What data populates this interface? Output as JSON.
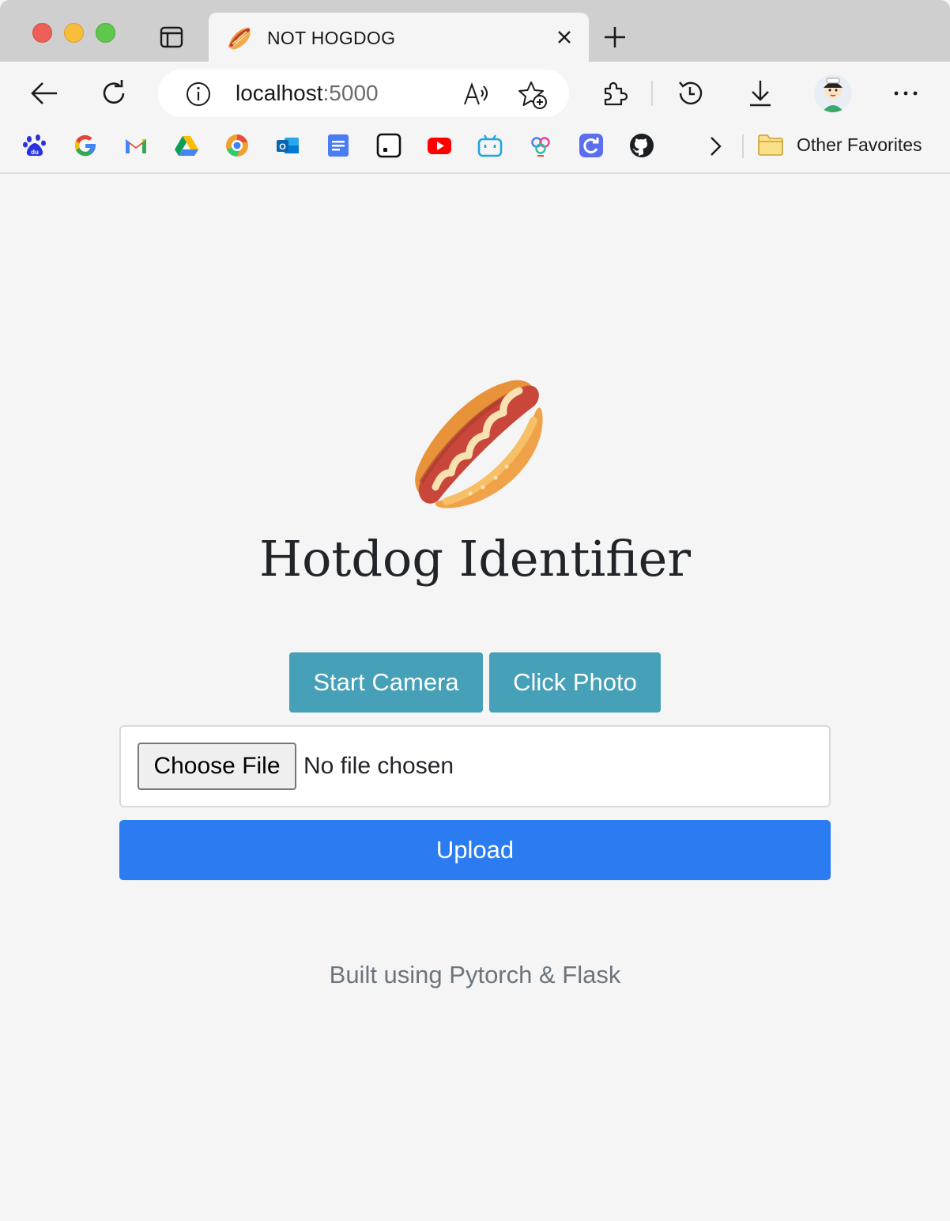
{
  "browser": {
    "tab": {
      "title": "NOT HOGDOG"
    },
    "address": {
      "host": "localhost",
      "port": ":5000"
    },
    "favorites": {
      "items": [
        "baidu-icon",
        "google-icon",
        "gmail-icon",
        "drive-icon",
        "chrome-like-icon",
        "outlook-icon",
        "docs-icon",
        "notion-icon",
        "youtube-icon",
        "bilibili-icon",
        "app-icon",
        "refresh-app-icon",
        "github-icon"
      ],
      "other_label": "Other Favorites"
    }
  },
  "page": {
    "title": "Hotdog Identifier",
    "start_camera_label": "Start Camera",
    "click_photo_label": "Click Photo",
    "choose_file_label": "Choose File",
    "file_status": "No file chosen",
    "upload_label": "Upload",
    "footer": "Built using Pytorch & Flask"
  },
  "colors": {
    "camera_button": "#45a0b8",
    "upload_button": "#2a7cf0",
    "footer_text": "#6c757d"
  }
}
